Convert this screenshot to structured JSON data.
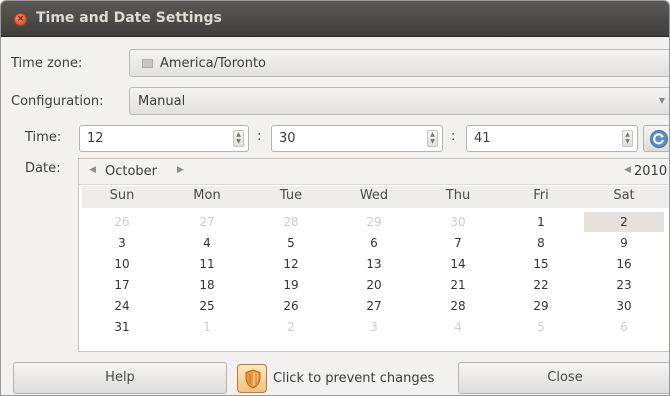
{
  "window": {
    "title": "Time and Date Settings"
  },
  "timezone": {
    "label": "Time zone:",
    "value": "America/Toronto"
  },
  "configuration": {
    "label": "Configuration:",
    "value": "Manual"
  },
  "time": {
    "label": "Time:",
    "hours": "12",
    "minutes": "30",
    "seconds": "41",
    "separator": ":"
  },
  "date": {
    "label": "Date:",
    "month": "October",
    "year": "2010",
    "weekdays": [
      "Sun",
      "Mon",
      "Tue",
      "Wed",
      "Thu",
      "Fri",
      "Sat"
    ],
    "weeks": [
      [
        "26",
        "27",
        "28",
        "29",
        "30",
        "1",
        "2"
      ],
      [
        "3",
        "4",
        "5",
        "6",
        "7",
        "8",
        "9"
      ],
      [
        "10",
        "11",
        "12",
        "13",
        "14",
        "15",
        "16"
      ],
      [
        "17",
        "18",
        "19",
        "20",
        "21",
        "22",
        "23"
      ],
      [
        "24",
        "25",
        "26",
        "27",
        "28",
        "29",
        "30"
      ],
      [
        "31",
        "1",
        "2",
        "3",
        "4",
        "5",
        "6"
      ]
    ],
    "selected_day": "2"
  },
  "buttons": {
    "help": "Help",
    "lock": "Click to prevent changes",
    "close": "Close"
  },
  "icons": {
    "lock": "lock-shield-icon",
    "refresh": "refresh-icon",
    "close": "close-icon"
  },
  "colors": {
    "titlebar": "#4c4b47",
    "close": "#e2532b",
    "lock": "#f4c27c"
  }
}
